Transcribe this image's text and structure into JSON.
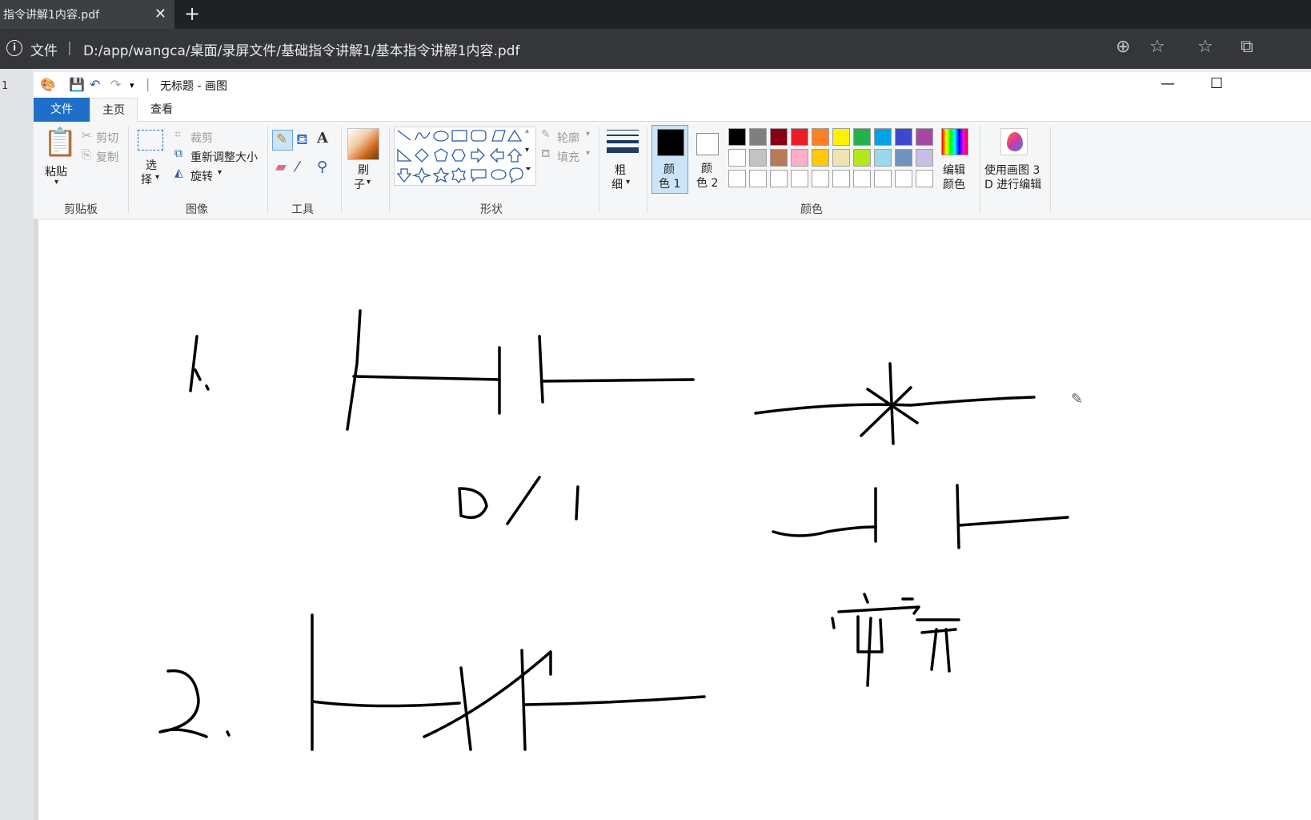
{
  "browser": {
    "tab_title": "指令讲解1内容.pdf",
    "tab_close": "✕",
    "new_tab": "+",
    "info_icon": "i",
    "address_label": "文件",
    "address_separator": "|",
    "url": "D:/app/wangca/桌面/录屏文件/基础指令讲解1/基本指令讲解1内容.pdf",
    "left_strip_text": "1"
  },
  "paint": {
    "title": "无标题 - 画图",
    "tabs": {
      "file": "文件",
      "home": "主页",
      "view": "查看"
    },
    "clipboard": {
      "paste": "粘贴",
      "cut": "剪切",
      "copy": "复制",
      "label": "剪贴板"
    },
    "image": {
      "select_1": "选",
      "select_2": "择",
      "crop": "裁剪",
      "resize": "重新调整大小",
      "rotate": "旋转",
      "label": "图像"
    },
    "tools": {
      "label": "工具",
      "text_tool": "A"
    },
    "brush": {
      "line1": "刷",
      "line2": "子"
    },
    "shapes": {
      "outline": "轮廓",
      "fill": "填充",
      "label": "形状"
    },
    "size": {
      "line1": "粗",
      "line2": "细"
    },
    "color1": {
      "line1": "颜",
      "line2": "色 1"
    },
    "color2": {
      "line1": "颜",
      "line2": "色 2"
    },
    "edit_colors": {
      "line1": "编辑",
      "line2": "颜色"
    },
    "paint3d": {
      "line1": "使用画图 3",
      "line2": "D 进行编辑"
    },
    "colors_label": "颜色",
    "palette_row1": [
      "#000000",
      "#7f7f7f",
      "#880015",
      "#ed1c24",
      "#ff7f27",
      "#fff200",
      "#22b14c",
      "#00a2e8",
      "#3f48cc",
      "#a349a4"
    ],
    "palette_row2": [
      "#ffffff",
      "#c3c3c3",
      "#b97a57",
      "#ffaec9",
      "#ffc90e",
      "#efe4b0",
      "#b5e61d",
      "#99d9ea",
      "#7092be",
      "#c8bfe7"
    ],
    "palette_row3": [
      "#ffffff",
      "#ffffff",
      "#ffffff",
      "#ffffff",
      "#ffffff",
      "#ffffff",
      "#ffffff",
      "#ffffff",
      "#ffffff",
      "#ffffff"
    ],
    "primary_color": "#000000",
    "secondary_color": "#ffffff"
  }
}
